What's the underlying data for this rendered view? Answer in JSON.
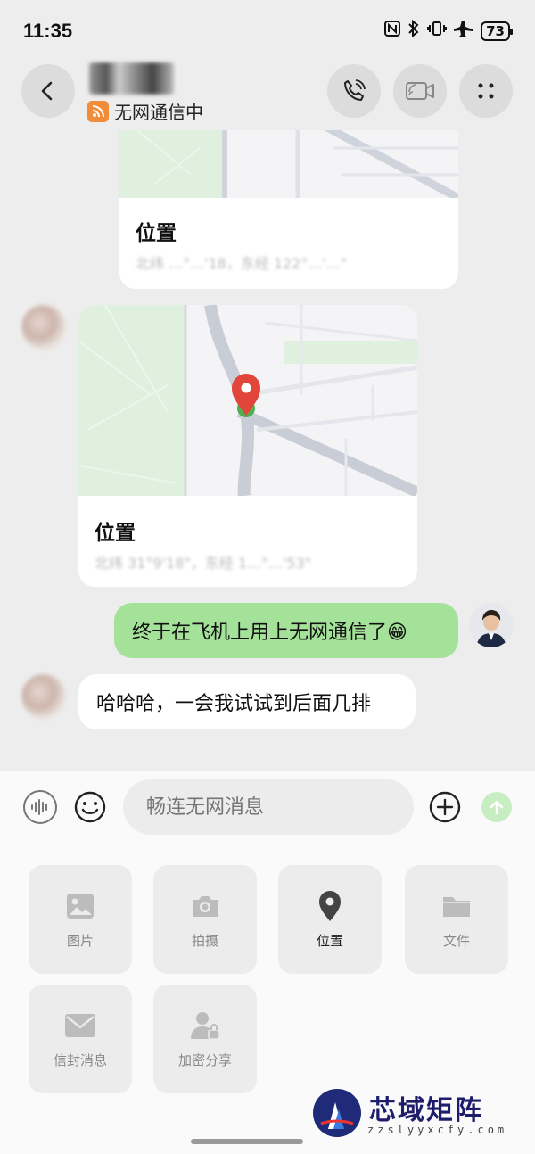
{
  "status_bar": {
    "time": "11:35",
    "battery": "73"
  },
  "header": {
    "network_status": "无网通信中"
  },
  "messages": [
    {
      "type": "location",
      "direction": "incoming",
      "title": "位置",
      "coords": "北纬 …°…'18，东经 122°…'…\""
    },
    {
      "type": "location",
      "direction": "incoming",
      "title": "位置",
      "coords": "北纬 31°9'18\"，东经 1…°…'53\""
    },
    {
      "type": "text",
      "direction": "outgoing",
      "text": "终于在飞机上用上无网通信了😁"
    },
    {
      "type": "text",
      "direction": "incoming",
      "text": "哈哈哈，一会我试试到后面几排"
    }
  ],
  "input": {
    "placeholder": "畅连无网消息"
  },
  "tools": [
    {
      "label": "图片",
      "icon": "image-icon"
    },
    {
      "label": "拍摄",
      "icon": "camera-icon"
    },
    {
      "label": "位置",
      "icon": "location-pin-icon",
      "active": true
    },
    {
      "label": "文件",
      "icon": "folder-icon"
    },
    {
      "label": "信封消息",
      "icon": "envelope-icon"
    },
    {
      "label": "加密分享",
      "icon": "encrypted-share-icon"
    }
  ],
  "watermark": {
    "name": "芯域矩阵",
    "url": "zzslyyxcfy.com"
  },
  "colors": {
    "bubble_out": "#a4e29a",
    "accent_orange": "#f08c3a",
    "pin_red": "#e2453a",
    "pin_green": "#4caf50"
  }
}
